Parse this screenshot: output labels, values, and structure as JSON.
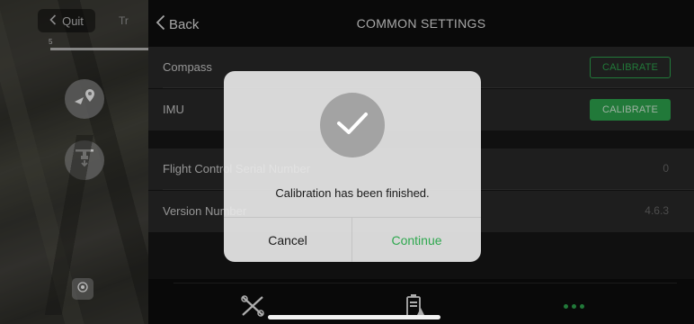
{
  "map": {
    "quit_label": "Quit",
    "partial_label": "Tr",
    "scale_label": "5"
  },
  "header": {
    "back_label": "Back",
    "title": "COMMON SETTINGS"
  },
  "settings": {
    "compass": {
      "label": "Compass",
      "button": "CALIBRATE"
    },
    "imu": {
      "label": "IMU",
      "button": "CALIBRATE"
    },
    "serial": {
      "label": "Flight Control Serial Number",
      "value": "0"
    },
    "version": {
      "label": "Version Number",
      "value": "4.6.3"
    }
  },
  "dialog": {
    "message": "Calibration has been finished.",
    "cancel": "Cancel",
    "continue": "Continue"
  },
  "icons": {
    "back": "chevron-left-icon",
    "quit": "chevron-left-icon",
    "route": "airplane-waypoint-icon",
    "drone": "drone-icon",
    "locate": "locate-icon",
    "tab_drone": "drone-tab-icon",
    "tab_battery": "battery-tab-icon",
    "tab_more": "more-dots-icon",
    "success": "checkmark-icon"
  },
  "colors": {
    "accent": "#2fa84f",
    "panel_bg": "#171717",
    "row_bg": "#2a2a2a"
  }
}
